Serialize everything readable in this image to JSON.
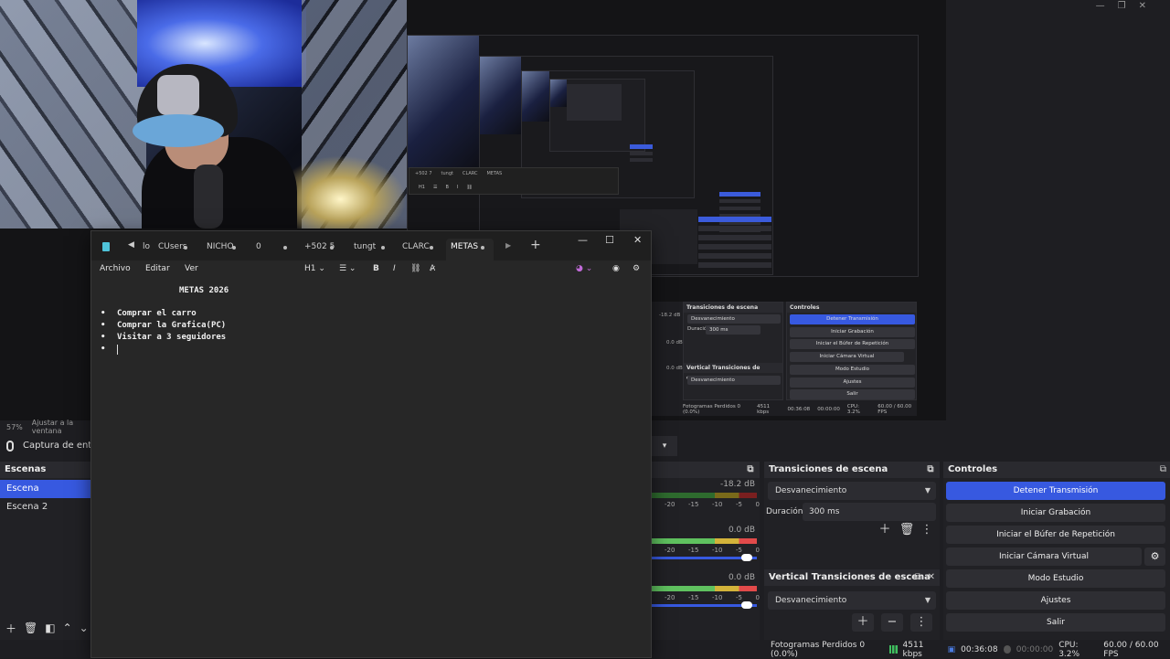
{
  "obs": {
    "window_controls": [
      "—",
      "❐",
      "✕"
    ],
    "zoom": "57%",
    "fit_label": "Ajustar a la ventana",
    "source_label": "Captura de entrada",
    "mini_docks": {
      "transitions_title": "Transiciones de escena",
      "transition_value": "Desvanecimiento",
      "duration_label": "Duración",
      "duration_value": "300 ms",
      "vertical_title": "Vertical Transiciones de escena",
      "vertical_value": "Desvanecimiento",
      "controls_title": "Controles",
      "controls": [
        "Detener Transmisión",
        "Iniciar Grabación",
        "Iniciar el Búfer de Repetición",
        "Iniciar Cámara Virtual",
        "Modo Estudio",
        "Ajustes",
        "Salir"
      ],
      "status": [
        "Fotogramas Perdidos 0 (0.0%)",
        "4511 kbps",
        "00:36:08",
        "00:00:00",
        "CPU: 3.2%",
        "60.00 / 60.00 FPS"
      ],
      "db_values": [
        "-18.2 dB",
        "0.0 dB",
        "0.0 dB"
      ]
    },
    "scenes": {
      "title": "Escenas",
      "items": [
        "Escena",
        "Escena 2"
      ]
    },
    "mixer": {
      "channels": [
        {
          "db": "-18.2 dB"
        },
        {
          "db": "0.0 dB"
        },
        {
          "db": "0.0 dB"
        }
      ],
      "scale": [
        "-20",
        "-15",
        "-10",
        "-5",
        "0"
      ]
    },
    "transitions": {
      "title": "Transiciones de escena",
      "value": "Desvanecimiento",
      "duration_label": "Duración",
      "duration_value": "300 ms",
      "vertical_title": "Vertical Transiciones de escena",
      "vertical_value": "Desvanecimiento"
    },
    "controls": {
      "title": "Controles",
      "stop_stream": "Detener Transmisión",
      "start_recording": "Iniciar Grabación",
      "replay_buffer": "Iniciar el Búfer de Repetición",
      "virtual_camera": "Iniciar Cámara Virtual",
      "studio_mode": "Modo Estudio",
      "settings": "Ajustes",
      "exit": "Salir"
    },
    "status": {
      "dropped_frames": "Fotogramas Perdidos 0 (0.0%)",
      "bitrate": "4511 kbps",
      "stream_time": "00:36:08",
      "record_time": "00:00:00",
      "cpu": "CPU: 3.2%",
      "fps": "60.00 / 60.00 FPS"
    }
  },
  "mini_notepad": {
    "tabs": [
      "+502 7",
      "tungt",
      "CLARC",
      "METAS"
    ],
    "tool_h1": "H1"
  },
  "notepad": {
    "tabs": [
      "lo",
      "CUsers",
      "NICHO",
      "0",
      "+502 5",
      "tungt",
      "CLARC",
      "METAS"
    ],
    "menus": [
      "Archivo",
      "Editar",
      "Ver"
    ],
    "heading_tool": "H1",
    "title": "METAS 2026",
    "items": [
      "Comprar el carro",
      "Comprar la Grafica(PC)",
      "Visitar a 3 seguidores",
      ""
    ]
  },
  "colors": {
    "accent": "#3759e0",
    "notepad_bg": "#272727"
  }
}
